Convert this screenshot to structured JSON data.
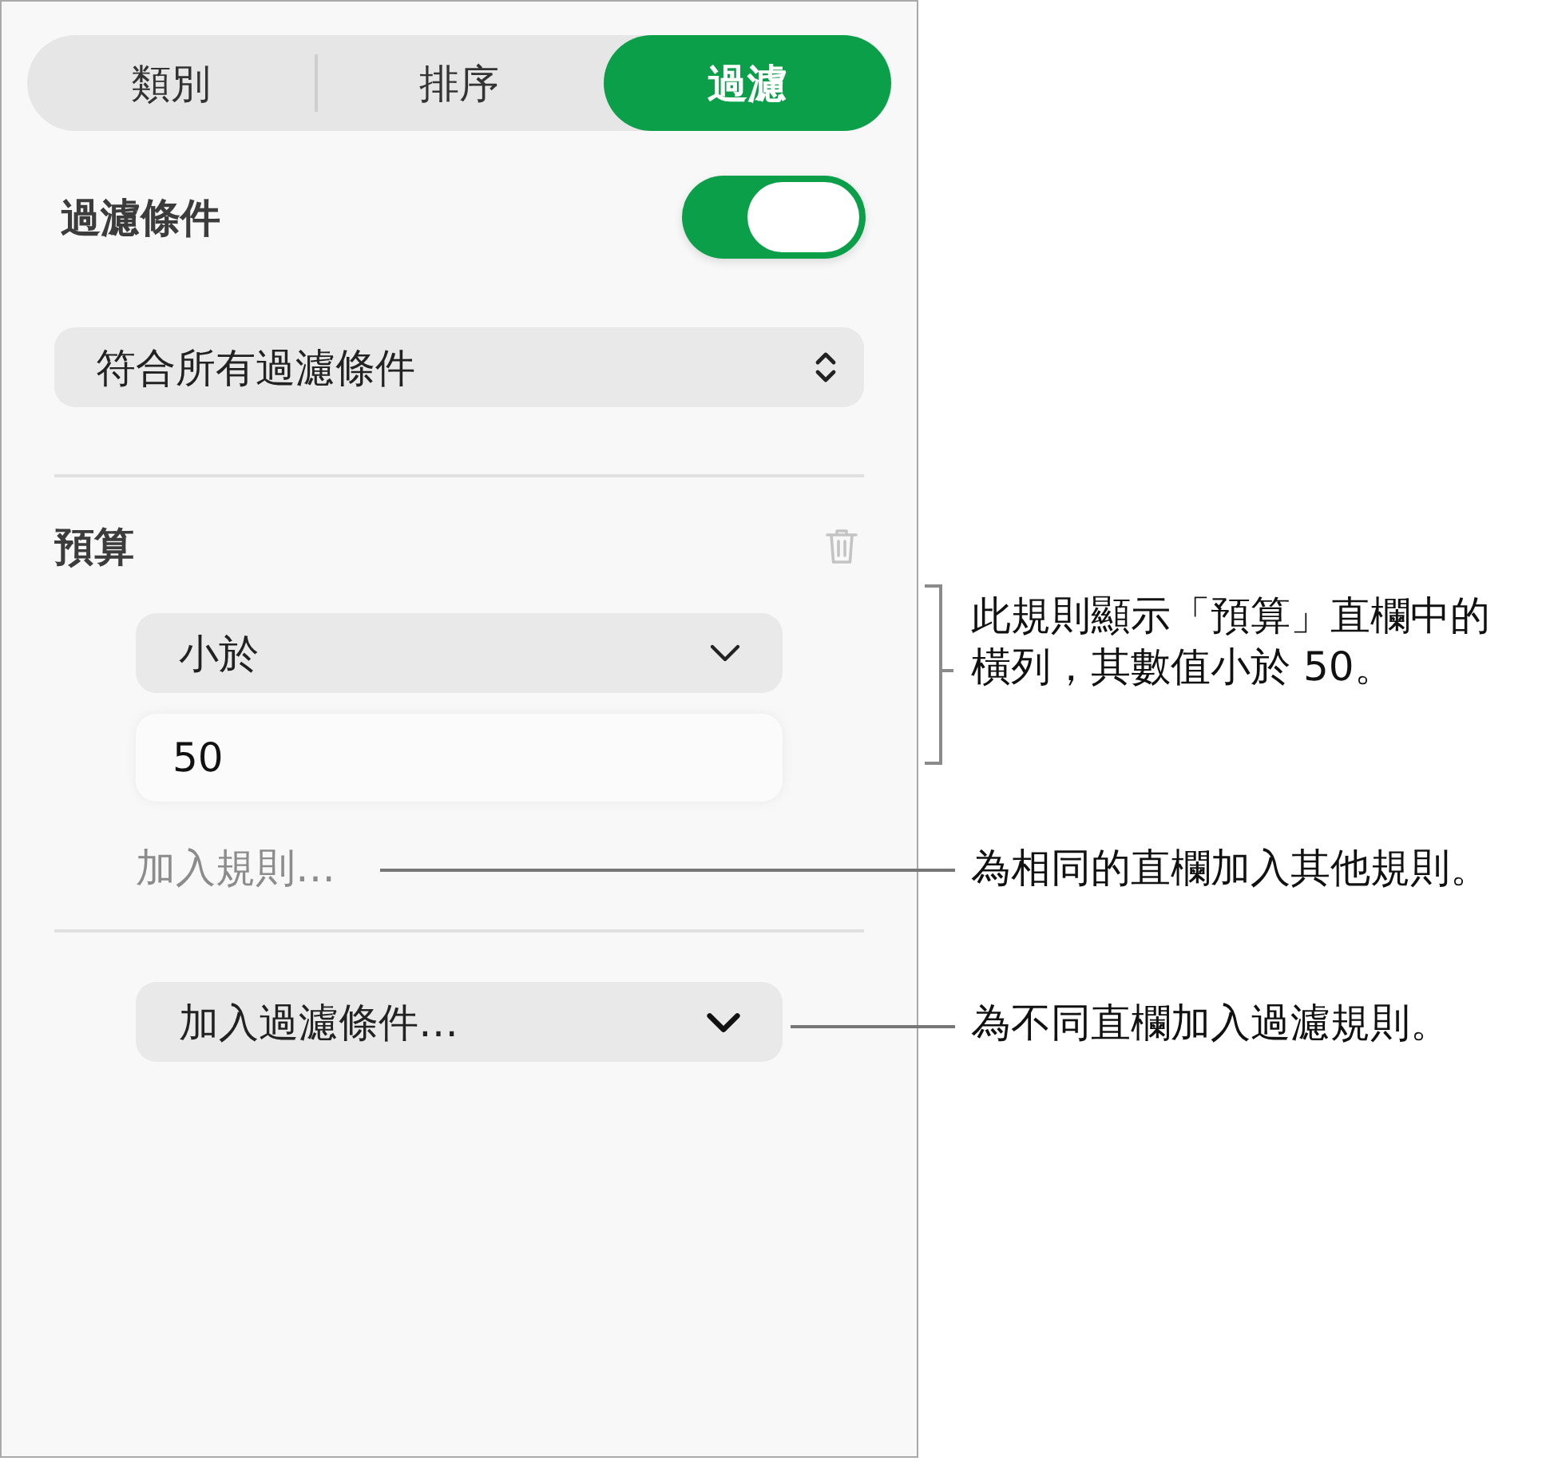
{
  "tabs": [
    {
      "label": "類別",
      "selected": false
    },
    {
      "label": "排序",
      "selected": false
    },
    {
      "label": "過濾",
      "selected": true
    }
  ],
  "filter_conditions": {
    "label": "過濾條件",
    "on": true
  },
  "match_popup": {
    "value": "符合所有過濾條件"
  },
  "rule_group": {
    "column": "預算",
    "operator": "小於",
    "value": "50",
    "add_rule": "加入規則…"
  },
  "add_filter": {
    "label": "加入過濾條件…"
  },
  "callouts": [
    {
      "kind": "bracket",
      "text": "此規則顯示「預算」直欄中的橫列，其數值小於 50。"
    },
    {
      "kind": "leader",
      "text": "為相同的直欄加入其他規則。"
    },
    {
      "kind": "leader",
      "text": "為不同直欄加入過濾規則。"
    }
  ]
}
